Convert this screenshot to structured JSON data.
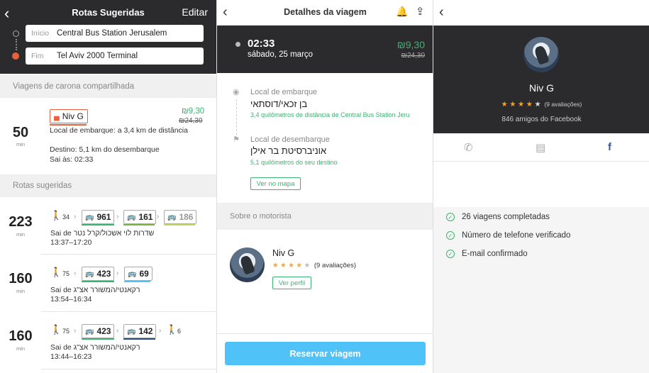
{
  "screen1": {
    "title": "Rotas Sugeridas",
    "edit_label": "Editar",
    "from_label": "Início",
    "from_value": "Central Bus Station Jerusalem",
    "to_label": "Fim",
    "to_value": "Tel Aviv 2000 Terminal",
    "carpool_section": "Viagens de carona compartilhada",
    "carpool": {
      "minutes": "50",
      "min_label": "min",
      "driver": "Niv G",
      "price": "₪9,30",
      "old_price": "₪24,30",
      "pickup": "Local de embarque: a 3,4 km de distância",
      "destination": "Destino: 5,1 km do desembarque",
      "departs": "Sai às: 02:33"
    },
    "routes_section": "Rotas sugeridas",
    "routes": [
      {
        "minutes": "223",
        "min_label": "min",
        "walk": "34",
        "buses": [
          "961",
          "161",
          "186"
        ],
        "leaves": "Sai de שדרות לוי אשכול/קרל נטר",
        "times": "13:37–17:20"
      },
      {
        "minutes": "160",
        "min_label": "min",
        "walk": "75",
        "buses": [
          "423",
          "69"
        ],
        "leaves": "Sai de רקאנטי/המשורר אצ\"ג",
        "times": "13:54–16:34"
      },
      {
        "minutes": "160",
        "min_label": "min",
        "walk": "75",
        "buses": [
          "423",
          "142"
        ],
        "walk_end": "6",
        "leaves": "Sai de רקאנטי/המשורר אצ\"ג",
        "times": "13:44–16:23"
      }
    ]
  },
  "screen2": {
    "title": "Detalhes da viagem",
    "time": "02:33",
    "date": "sábado, 25 março",
    "price": "₪9,30",
    "old_price": "₪24,30",
    "pickup_label": "Local de embarque",
    "pickup_value": "בן זכאי/דוסתאי",
    "pickup_distance": "3,4 quilômetros de distância de Central Bus Station Jeru",
    "dropoff_label": "Local de desembarque",
    "dropoff_value": "אוניברסיטת בר אילן",
    "dropoff_distance": "5,1 quilômetros do seu destino",
    "map_button": "Ver no mapa",
    "about_driver": "Sobre o motorista",
    "driver_name": "Niv G",
    "reviews": "(9 avaliações)",
    "rating": 4,
    "profile_button": "Ver perfil",
    "reserve_button": "Reservar viagem"
  },
  "screen3": {
    "name": "Niv G",
    "reviews": "(9 avaliações)",
    "rating": 4,
    "facebook_friends": "846 amigos do Facebook",
    "verifications": [
      "26 viagens completadas",
      "Número de telefone verificado",
      "E-mail confirmado"
    ]
  },
  "colors": {
    "dark_header": "#2b2b2e",
    "accent_green": "#3cb371",
    "carpool_orange": "#e8603c",
    "reserve_blue": "#4fc3f7",
    "star": "#f5a623"
  }
}
